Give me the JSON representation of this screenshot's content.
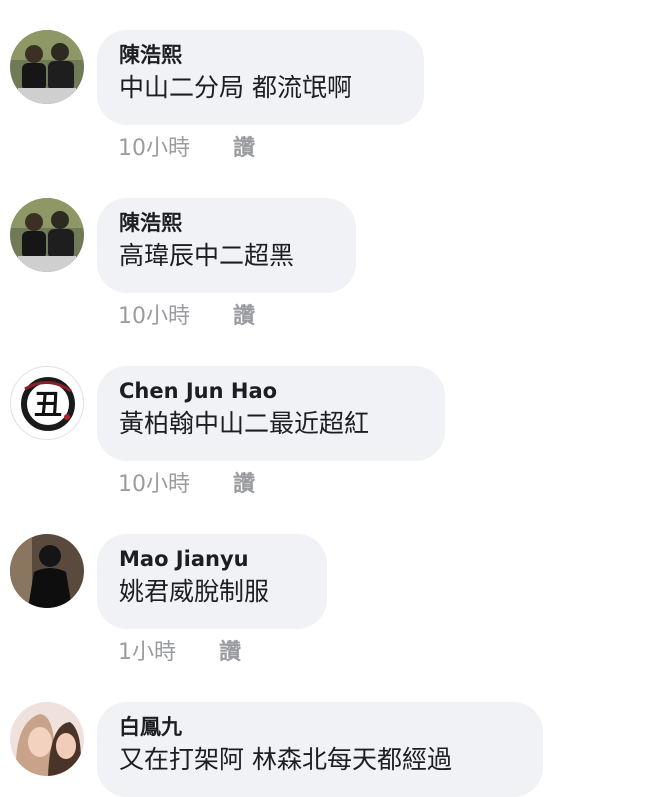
{
  "comments": [
    {
      "name": "陳浩熙",
      "text": "中山二分局 都流氓啊",
      "time": "10小時",
      "like": "讚",
      "avatar": "group-photo-avatar"
    },
    {
      "name": "陳浩熙",
      "text": "高瑋辰中二超黑",
      "time": "10小時",
      "like": "讚",
      "avatar": "group-photo-avatar"
    },
    {
      "name": "Chen Jun Hao",
      "text": "黃柏翰中山二最近超紅",
      "time": "10小時",
      "like": "讚",
      "avatar": "calligraphy-avatar",
      "avatar_glyph": "丑"
    },
    {
      "name": "Mao Jianyu",
      "text": "姚君威脫制服",
      "time": "1小時",
      "like": "讚",
      "avatar": "dark-figure-avatar"
    },
    {
      "name": "白鳳九",
      "text": "又在打架阿 林森北每天都經過",
      "time": "",
      "like": "",
      "avatar": "selfie-avatar"
    }
  ],
  "colors": {
    "bubble": "#f0f2f5",
    "meta": "#9a9ca0",
    "text": "#1c1e21"
  }
}
